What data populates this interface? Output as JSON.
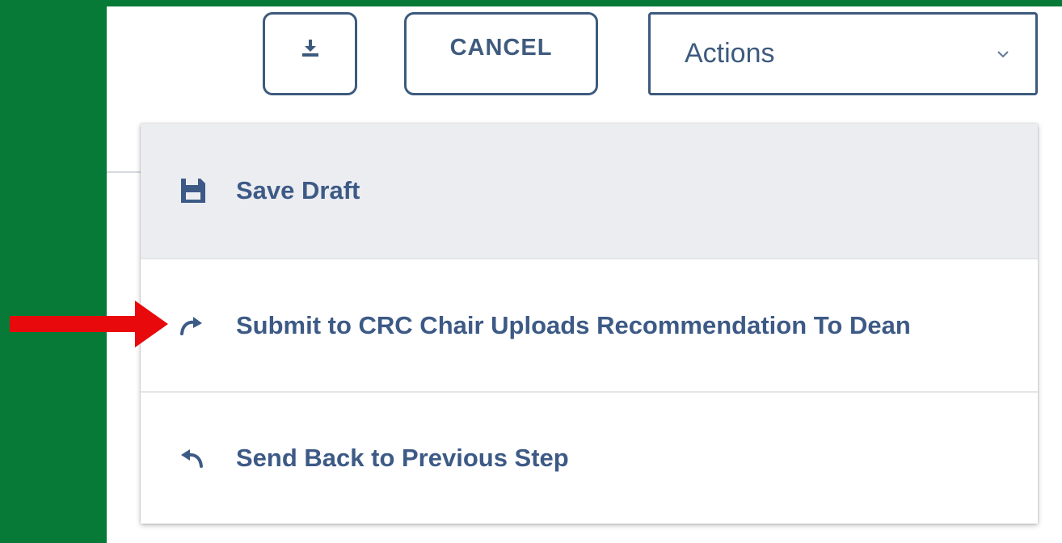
{
  "toolbar": {
    "download_icon": "download-icon",
    "cancel_label": "CANCEL"
  },
  "actions_select": {
    "selected": "Actions",
    "icon": "chevron-down-icon"
  },
  "actions_menu": {
    "items": [
      {
        "label": "Save Draft",
        "icon": "save-icon"
      },
      {
        "label": "Submit to CRC Chair Uploads Recommendation To Dean",
        "icon": "redo-arrow-icon"
      },
      {
        "label": "Send Back to Previous Step",
        "icon": "undo-arrow-icon"
      }
    ]
  },
  "annotation": {
    "arrow_color": "#e8090c",
    "arrow_icon": "red-pointer-arrow"
  },
  "colors": {
    "background_green": "#067a36",
    "button_border": "#3d5a7d",
    "menu_text": "#3d5a86",
    "highlight_row": "#ecedf1"
  }
}
